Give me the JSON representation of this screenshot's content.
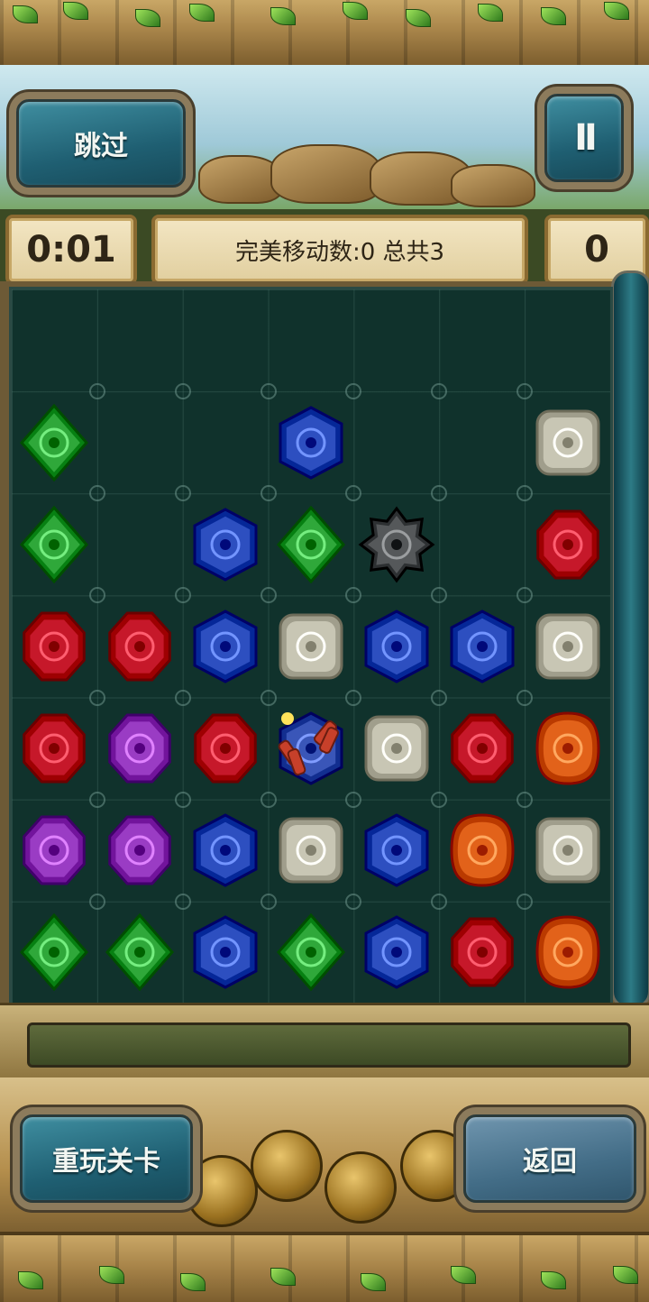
{
  "header": {
    "skip_label": "跳过",
    "pause_label": "II"
  },
  "status": {
    "timer": "0:01",
    "moves_text": "完美移动数:0 总共3",
    "score": "0"
  },
  "progress": {
    "fraction": 0.0
  },
  "board": {
    "columns": 7,
    "rows": 7,
    "grid": [
      [
        null,
        null,
        null,
        null,
        null,
        null,
        null
      ],
      [
        "green",
        null,
        null,
        "blue",
        null,
        null,
        "silver"
      ],
      [
        "green",
        null,
        "blue",
        "green",
        "obsidian",
        null,
        "red"
      ],
      [
        "red",
        "red",
        "blue",
        "silver",
        "blue",
        "blue",
        "silver"
      ],
      [
        "red",
        "purple",
        "red",
        "dynamite",
        "silver",
        "red",
        "orange"
      ],
      [
        "purple",
        "purple",
        "blue",
        "silver",
        "blue",
        "orange",
        "silver"
      ],
      [
        "green",
        "green",
        "blue",
        "green",
        "blue",
        "red",
        "orange"
      ]
    ],
    "colors": {
      "green": "#2fa83a",
      "blue": "#2d4fc0",
      "silver": "#c8c6b4",
      "red": "#c6182a",
      "purple": "#9a3cc4",
      "orange": "#e2621a",
      "obsidian": "#55585a",
      "dynamite": "#3a56b8"
    }
  },
  "footer": {
    "replay_label": "重玩关卡",
    "back_label": "返回"
  }
}
